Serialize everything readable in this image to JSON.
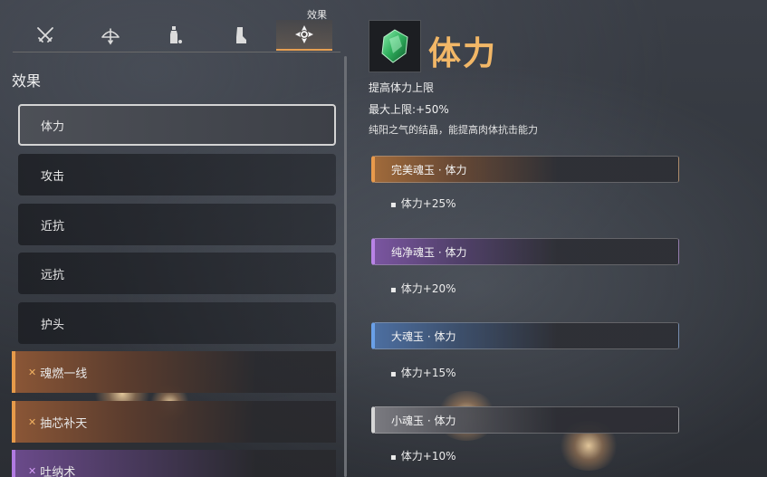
{
  "tabs": [
    {
      "icon": "crossed-swords-icon"
    },
    {
      "icon": "bow-icon"
    },
    {
      "icon": "potion-bottle-icon"
    },
    {
      "icon": "boot-icon"
    },
    {
      "icon": "effect-emblem-icon",
      "caption": "效果",
      "active": true
    }
  ],
  "section_title": "效果",
  "list": [
    {
      "label": "体力",
      "style": "selected"
    },
    {
      "label": "攻击",
      "style": "plain"
    },
    {
      "label": "近抗",
      "style": "plain"
    },
    {
      "label": "远抗",
      "style": "plain"
    },
    {
      "label": "护头",
      "style": "plain"
    },
    {
      "label": "魂燃一线",
      "style": "orange"
    },
    {
      "label": "抽芯补天",
      "style": "orange"
    },
    {
      "label": "吐纳术",
      "style": "purple"
    }
  ],
  "detail": {
    "icon": "green-jade-gem-icon",
    "title": "体力",
    "desc1": "提高体力上限",
    "desc2": "最大上限:+50%",
    "desc3": "纯阳之气的结晶，能提高肉体抗击能力",
    "tiers": [
      {
        "name": "完美魂玉 · 体力",
        "bonus": "体力+25%",
        "color": "#e89a4c"
      },
      {
        "name": "纯净魂玉 · 体力",
        "bonus": "体力+20%",
        "color": "#b883e6"
      },
      {
        "name": "大魂玉 · 体力",
        "bonus": "体力+15%",
        "color": "#6aa0e8"
      },
      {
        "name": "小魂玉 · 体力",
        "bonus": "体力+10%",
        "color": "#d6d6d6"
      }
    ]
  },
  "colors": {
    "accent_gold": "#f2b767",
    "tab_active_underline": "#e8a052"
  }
}
